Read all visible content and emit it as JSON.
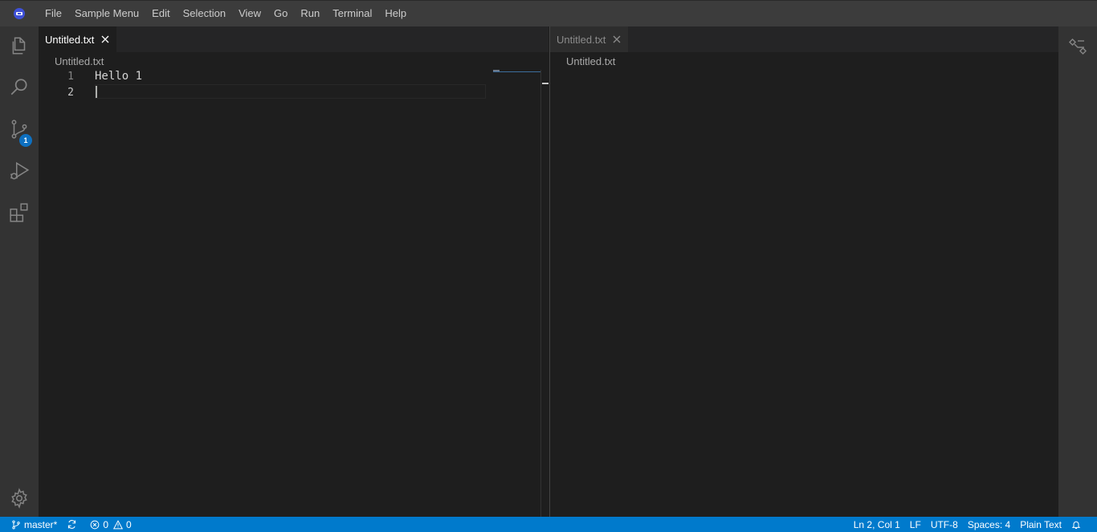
{
  "menubar": {
    "items": [
      "File",
      "Sample Menu",
      "Edit",
      "Selection",
      "View",
      "Go",
      "Run",
      "Terminal",
      "Help"
    ]
  },
  "activitybar": {
    "items": [
      {
        "icon": "files-icon",
        "name": "Explorer"
      },
      {
        "icon": "search-icon",
        "name": "Search"
      },
      {
        "icon": "source-control-icon",
        "name": "Source Control",
        "badge": "1"
      },
      {
        "icon": "run-debug-icon",
        "name": "Run and Debug"
      },
      {
        "icon": "extensions-icon",
        "name": "Extensions"
      }
    ],
    "manage_icon": "gear-icon"
  },
  "editor_left": {
    "tab": "Untitled.txt",
    "breadcrumb": "Untitled.txt",
    "line_numbers": [
      "1",
      "2"
    ],
    "lines": [
      "Hello 1",
      ""
    ]
  },
  "editor_right": {
    "tab": "Untitled.txt",
    "breadcrumb": "Untitled.txt"
  },
  "auxbar": {
    "icon": "outline-icon"
  },
  "statusbar": {
    "branch": "master*",
    "errors": "0",
    "warnings": "0",
    "cursor_position": "Ln 2, Col 1",
    "eol": "LF",
    "encoding": "UTF-8",
    "indentation": "Spaces: 4",
    "language": "Plain Text"
  },
  "colors": {
    "accent": "#007acc",
    "badge": "#0e70c0"
  }
}
